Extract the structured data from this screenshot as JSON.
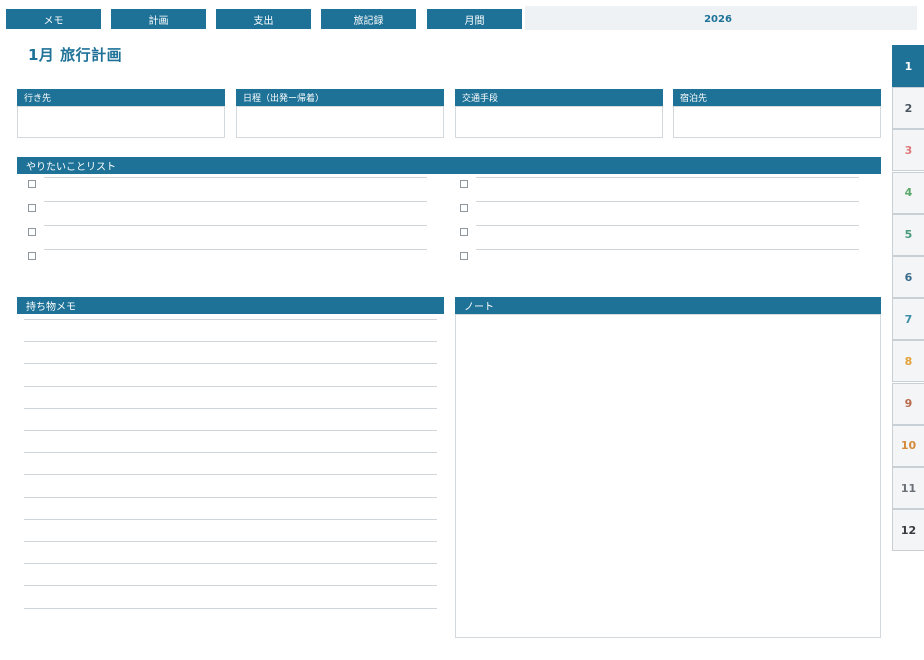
{
  "nav": {
    "tabs": [
      {
        "label": "メモ"
      },
      {
        "label": "計画"
      },
      {
        "label": "支出"
      },
      {
        "label": "旅記録"
      },
      {
        "label": "月間"
      }
    ],
    "year": "2026"
  },
  "page": {
    "title": "1月 旅行計画"
  },
  "info_cards": [
    {
      "label": "行き先",
      "value": ""
    },
    {
      "label": "日程（出発ー帰着）",
      "value": ""
    },
    {
      "label": "交通手段",
      "value": ""
    },
    {
      "label": "宿泊先",
      "value": ""
    }
  ],
  "todo": {
    "title": "やりたいことリスト",
    "left_items": [
      "",
      "",
      "",
      ""
    ],
    "right_items": [
      "",
      "",
      "",
      ""
    ]
  },
  "packing": {
    "title": "持ち物メモ",
    "lines": 14
  },
  "notes": {
    "title": "ノート",
    "value": ""
  },
  "months": [
    {
      "label": "1",
      "color": "#ffffff"
    },
    {
      "label": "2",
      "color": "#4a5560"
    },
    {
      "label": "3",
      "color": "#e0787a"
    },
    {
      "label": "4",
      "color": "#5aa86b"
    },
    {
      "label": "5",
      "color": "#4a9a7c"
    },
    {
      "label": "6",
      "color": "#3a6a8a"
    },
    {
      "label": "7",
      "color": "#3b8fa8"
    },
    {
      "label": "8",
      "color": "#e3a13a"
    },
    {
      "label": "9",
      "color": "#b86a4a"
    },
    {
      "label": "10",
      "color": "#d48a3a"
    },
    {
      "label": "11",
      "color": "#6a7075"
    },
    {
      "label": "12",
      "color": "#3a3a40"
    }
  ],
  "active_month": "1",
  "colors": {
    "accent": "#1e7297"
  }
}
